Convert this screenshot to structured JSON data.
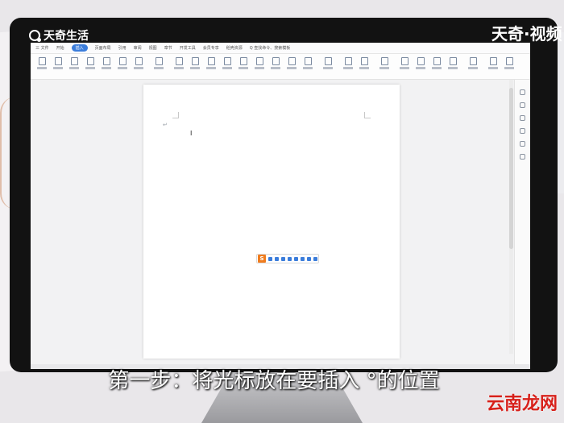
{
  "brand_left": "天奇生活",
  "brand_right": "天奇·视频",
  "menu": {
    "items": [
      "三 文件",
      "开始",
      "插入",
      "页面布局",
      "引用",
      "审阅",
      "视图",
      "章节",
      "开发工具",
      "会员专享",
      "稻壳资源",
      "Q 查找命令、搜索模板"
    ],
    "active_index": 2
  },
  "ime": {
    "logo": "S"
  },
  "subtitle": "第一步：将光标放在要插入 °的位置",
  "watermark": "云南龙网",
  "colors": {
    "accent": "#3b7ddb",
    "ime_orange": "#f07c1e",
    "watermark_red": "#d7211b"
  }
}
